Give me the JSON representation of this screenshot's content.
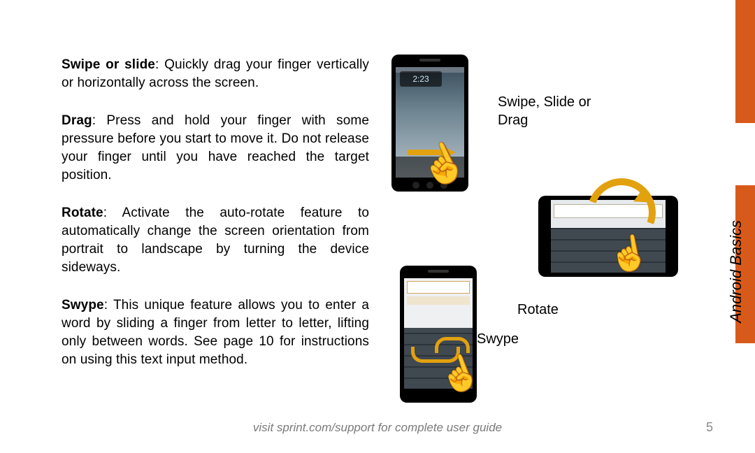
{
  "section_title": "Android Basics",
  "page_number": "5",
  "footer": "visit sprint.com/support for complete user guide",
  "terms": {
    "swipe": {
      "label": "Swipe or slide",
      "text": ": Quickly drag your finger vertically or horizontally across the screen."
    },
    "drag": {
      "label": "Drag",
      "text": ": Press and hold your finger  with some pressure before you start to move it. Do not release your finger until you have reached the target position."
    },
    "rotate": {
      "label": "Rotate",
      "text": ": Activate the auto-rotate feature to automatically change the screen orientation from portrait to landscape by turning the device sideways."
    },
    "swype": {
      "label": "Swype",
      "text": ": This unique feature allows you to enter a word by sliding a finger from letter to letter, lifting only between words. See page 10 for instructions on using this text input method."
    }
  },
  "captions": {
    "swipe": "Swipe, Slide or Drag",
    "rotate": "Rotate",
    "swype": "Swype"
  },
  "phone": {
    "clock": "2:23"
  }
}
